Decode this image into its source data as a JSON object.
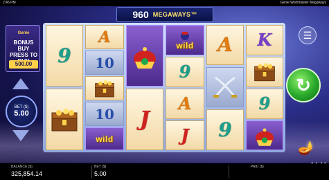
{
  "status_bar": {
    "time": "2:46 PM",
    "title": "Genie Wishmaster Megaways"
  },
  "megaways": {
    "count": "960",
    "label": "MEGAWAYS™"
  },
  "promo": {
    "line1": "Genie",
    "line2": "BONUS BUY PRESS TO BUY",
    "price": "500.00"
  },
  "bet_control": {
    "label": "BET ($)",
    "value": "5.00"
  },
  "clock": "14:44",
  "footer": {
    "balance_label": "BALANCE ($)",
    "balance_value": "325,854.14",
    "bet_label": "BET ($)",
    "bet_value": "5.00",
    "paid_label": "PAID ($)",
    "paid_value": ""
  },
  "reels": [
    [
      "9",
      "chest"
    ],
    [
      "A",
      "10",
      "chest",
      "10",
      "wild"
    ],
    [
      "crown",
      "J"
    ],
    [
      "wild",
      "9",
      "A",
      "J"
    ],
    [
      "A",
      "swords",
      "9"
    ],
    [
      "K",
      "chest",
      "9",
      "crown"
    ]
  ],
  "symbol_colors": {
    "9": "#1e9e8a",
    "10": "#2a4fa8",
    "A": "#e07c10",
    "J": "#d0231f",
    "K": "#7a3fc8",
    "wild": "#ffe24a"
  },
  "icons": [
    "menu-icon",
    "spin-icon",
    "lamp-icon",
    "up-arrow-icon",
    "down-arrow-icon"
  ]
}
